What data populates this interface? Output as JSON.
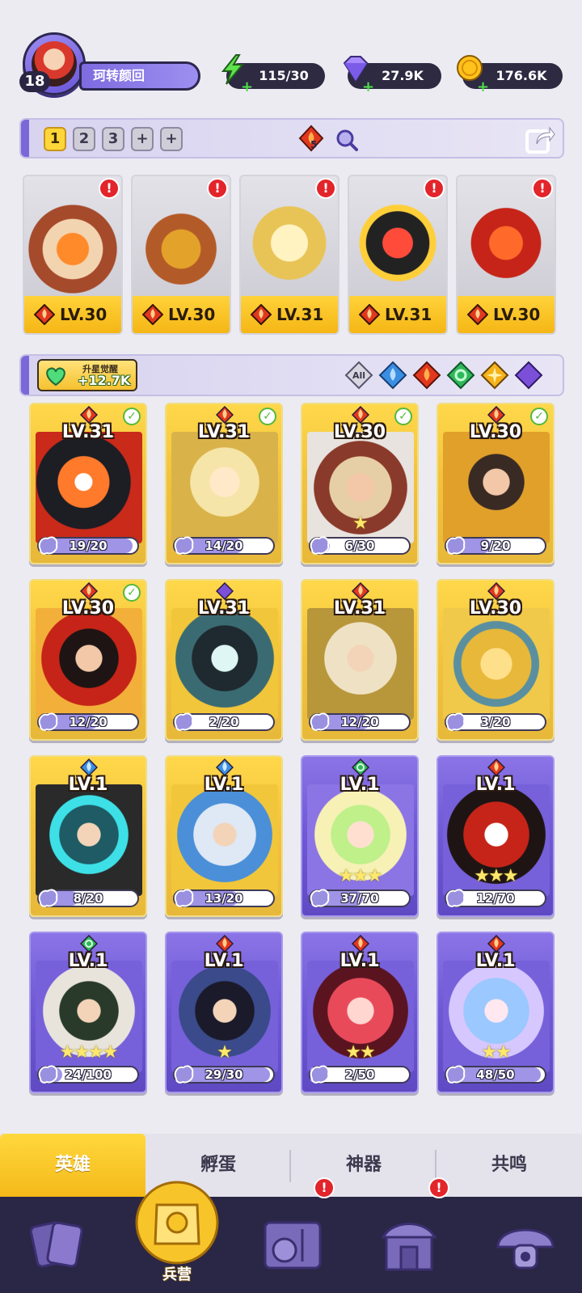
{
  "player": {
    "level": "18",
    "name": "珂转颜回"
  },
  "resources": {
    "energy": "115/30",
    "gems": "27.9K",
    "coins": "176.6K"
  },
  "team_bar": {
    "slots": [
      "1",
      "2",
      "3",
      "+",
      "+"
    ],
    "active_slot": "1",
    "fire_count": "5"
  },
  "team": [
    {
      "level": "LV.30",
      "element": "fire",
      "alert": "!"
    },
    {
      "level": "LV.30",
      "element": "fire",
      "alert": "!"
    },
    {
      "level": "LV.31",
      "element": "fire",
      "alert": "!"
    },
    {
      "level": "LV.31",
      "element": "fire",
      "alert": "!"
    },
    {
      "level": "LV.30",
      "element": "fire",
      "alert": "!"
    }
  ],
  "filter": {
    "awaken_label": "升星觉醒",
    "awaken_value": "+12.7K",
    "elements": [
      "All",
      "water",
      "fire",
      "wind",
      "light",
      "dark"
    ]
  },
  "heroes": [
    {
      "level": "LV.31",
      "element": "fire",
      "fragments": "19/20",
      "progress": 0.95,
      "ready": true,
      "rarity": "gold",
      "stars": ""
    },
    {
      "level": "LV.31",
      "element": "fire",
      "fragments": "14/20",
      "progress": 0.7,
      "ready": true,
      "rarity": "gold",
      "stars": ""
    },
    {
      "level": "LV.30",
      "element": "fire",
      "fragments": "6/30",
      "progress": 0.2,
      "ready": true,
      "rarity": "gold",
      "stars": "★"
    },
    {
      "level": "LV.30",
      "element": "fire",
      "fragments": "9/20",
      "progress": 0.45,
      "ready": true,
      "rarity": "gold",
      "stars": ""
    },
    {
      "level": "LV.30",
      "element": "fire",
      "fragments": "12/20",
      "progress": 0.6,
      "ready": true,
      "rarity": "gold",
      "stars": ""
    },
    {
      "level": "LV.31",
      "element": "dark",
      "fragments": "2/20",
      "progress": 0.1,
      "ready": false,
      "rarity": "gold",
      "stars": ""
    },
    {
      "level": "LV.31",
      "element": "fire",
      "fragments": "12/20",
      "progress": 0.6,
      "ready": false,
      "rarity": "gold",
      "stars": ""
    },
    {
      "level": "LV.30",
      "element": "fire",
      "fragments": "3/20",
      "progress": 0.15,
      "ready": false,
      "rarity": "gold",
      "stars": ""
    },
    {
      "level": "LV.1",
      "element": "water",
      "fragments": "8/20",
      "progress": 0.4,
      "ready": false,
      "rarity": "gold",
      "stars": ""
    },
    {
      "level": "LV.1",
      "element": "water",
      "fragments": "13/20",
      "progress": 0.65,
      "ready": false,
      "rarity": "gold",
      "stars": ""
    },
    {
      "level": "LV.1",
      "element": "wind",
      "fragments": "37/70",
      "progress": 0.53,
      "ready": false,
      "rarity": "purple",
      "stars": "★★★"
    },
    {
      "level": "LV.1",
      "element": "fire",
      "fragments": "12/70",
      "progress": 0.17,
      "ready": false,
      "rarity": "purple",
      "stars": "★★★"
    },
    {
      "level": "LV.1",
      "element": "wind",
      "fragments": "24/100",
      "progress": 0.24,
      "ready": false,
      "rarity": "purple",
      "stars": "★★★★"
    },
    {
      "level": "LV.1",
      "element": "fire",
      "fragments": "29/30",
      "progress": 0.97,
      "ready": false,
      "rarity": "purple",
      "stars": "★"
    },
    {
      "level": "LV.1",
      "element": "fire",
      "fragments": "2/50",
      "progress": 0.04,
      "ready": false,
      "rarity": "purple",
      "stars": "★★"
    },
    {
      "level": "LV.1",
      "element": "fire",
      "fragments": "48/50",
      "progress": 0.96,
      "ready": false,
      "rarity": "purple",
      "stars": "★★"
    }
  ],
  "subtabs": [
    "英雄",
    "孵蛋",
    "神器",
    "共鸣"
  ],
  "active_subtab": "英雄",
  "nav": {
    "items": [
      "cards",
      "barracks",
      "map",
      "shrine",
      "mushroom"
    ],
    "active_label": "兵营",
    "alerts": {
      "map": "!",
      "shrine": "!"
    }
  },
  "colors": {
    "fire": "#e2381e",
    "water": "#3a8fe3",
    "wind": "#2fb85a",
    "light": "#f5b21a",
    "dark": "#7c4fd8",
    "gold": "#ffd23a",
    "purple": "#7a66dc"
  }
}
